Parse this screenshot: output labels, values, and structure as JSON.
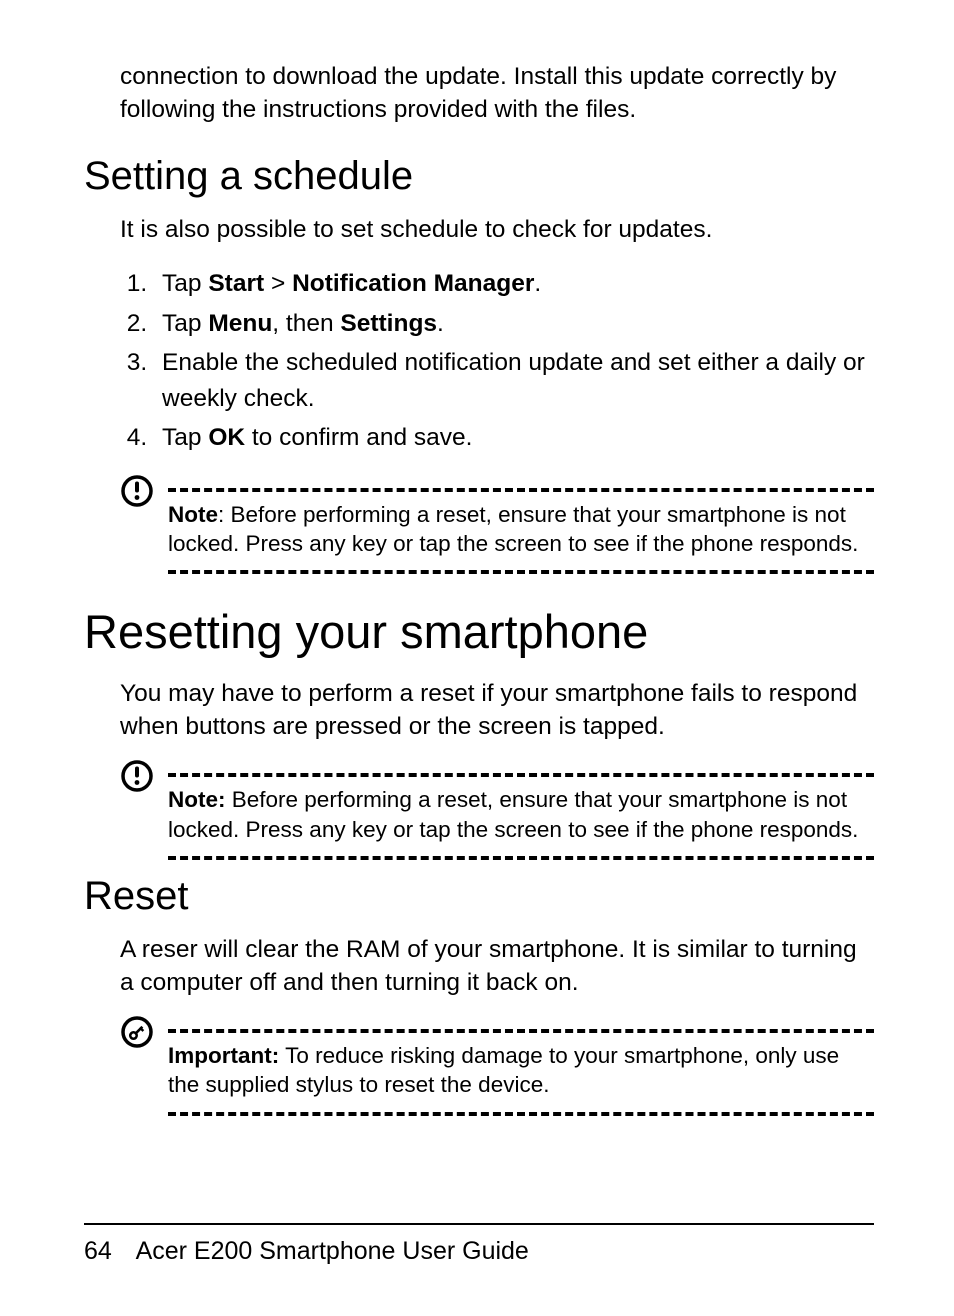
{
  "intro_paragraph": "connection to download the update. Install this update correctly by following the instructions provided with the files.",
  "section1": {
    "heading": "Setting a schedule",
    "lead": "It is also possible to set schedule to check for updates.",
    "steps": [
      {
        "pre": "Tap ",
        "b1": "Start",
        "mid": " > ",
        "b2": "Notification Manager",
        "post": "."
      },
      {
        "pre": "Tap ",
        "b1": "Menu",
        "mid": ", then ",
        "b2": "Settings",
        "post": "."
      },
      {
        "plain": "Enable the scheduled notification update and set either a daily or weekly check."
      },
      {
        "pre": "Tap ",
        "b1": "OK",
        "post": " to confirm and save."
      }
    ],
    "note": {
      "label": "Note",
      "text": ": Before performing a reset, ensure that your smartphone is not locked. Press any key or tap the screen to see if the phone responds."
    }
  },
  "section2": {
    "heading": "Resetting your smartphone",
    "lead": "You may have to perform a reset if your smartphone fails to respond when buttons are pressed or the screen is tapped.",
    "note": {
      "label": "Note:",
      "text": " Before performing a reset, ensure that your smartphone is not locked. Press any key or tap the screen to see if the phone responds."
    }
  },
  "section3": {
    "heading": "Reset",
    "lead": "A reser will clear the RAM of your smartphone. It is similar to turning a computer off and then turning it back on.",
    "important": {
      "label": "Important:",
      "text": " To reduce risking damage to your smartphone, only use the supplied stylus to reset the device."
    }
  },
  "footer": {
    "page_number": "64",
    "title": "Acer E200 Smartphone User Guide"
  }
}
